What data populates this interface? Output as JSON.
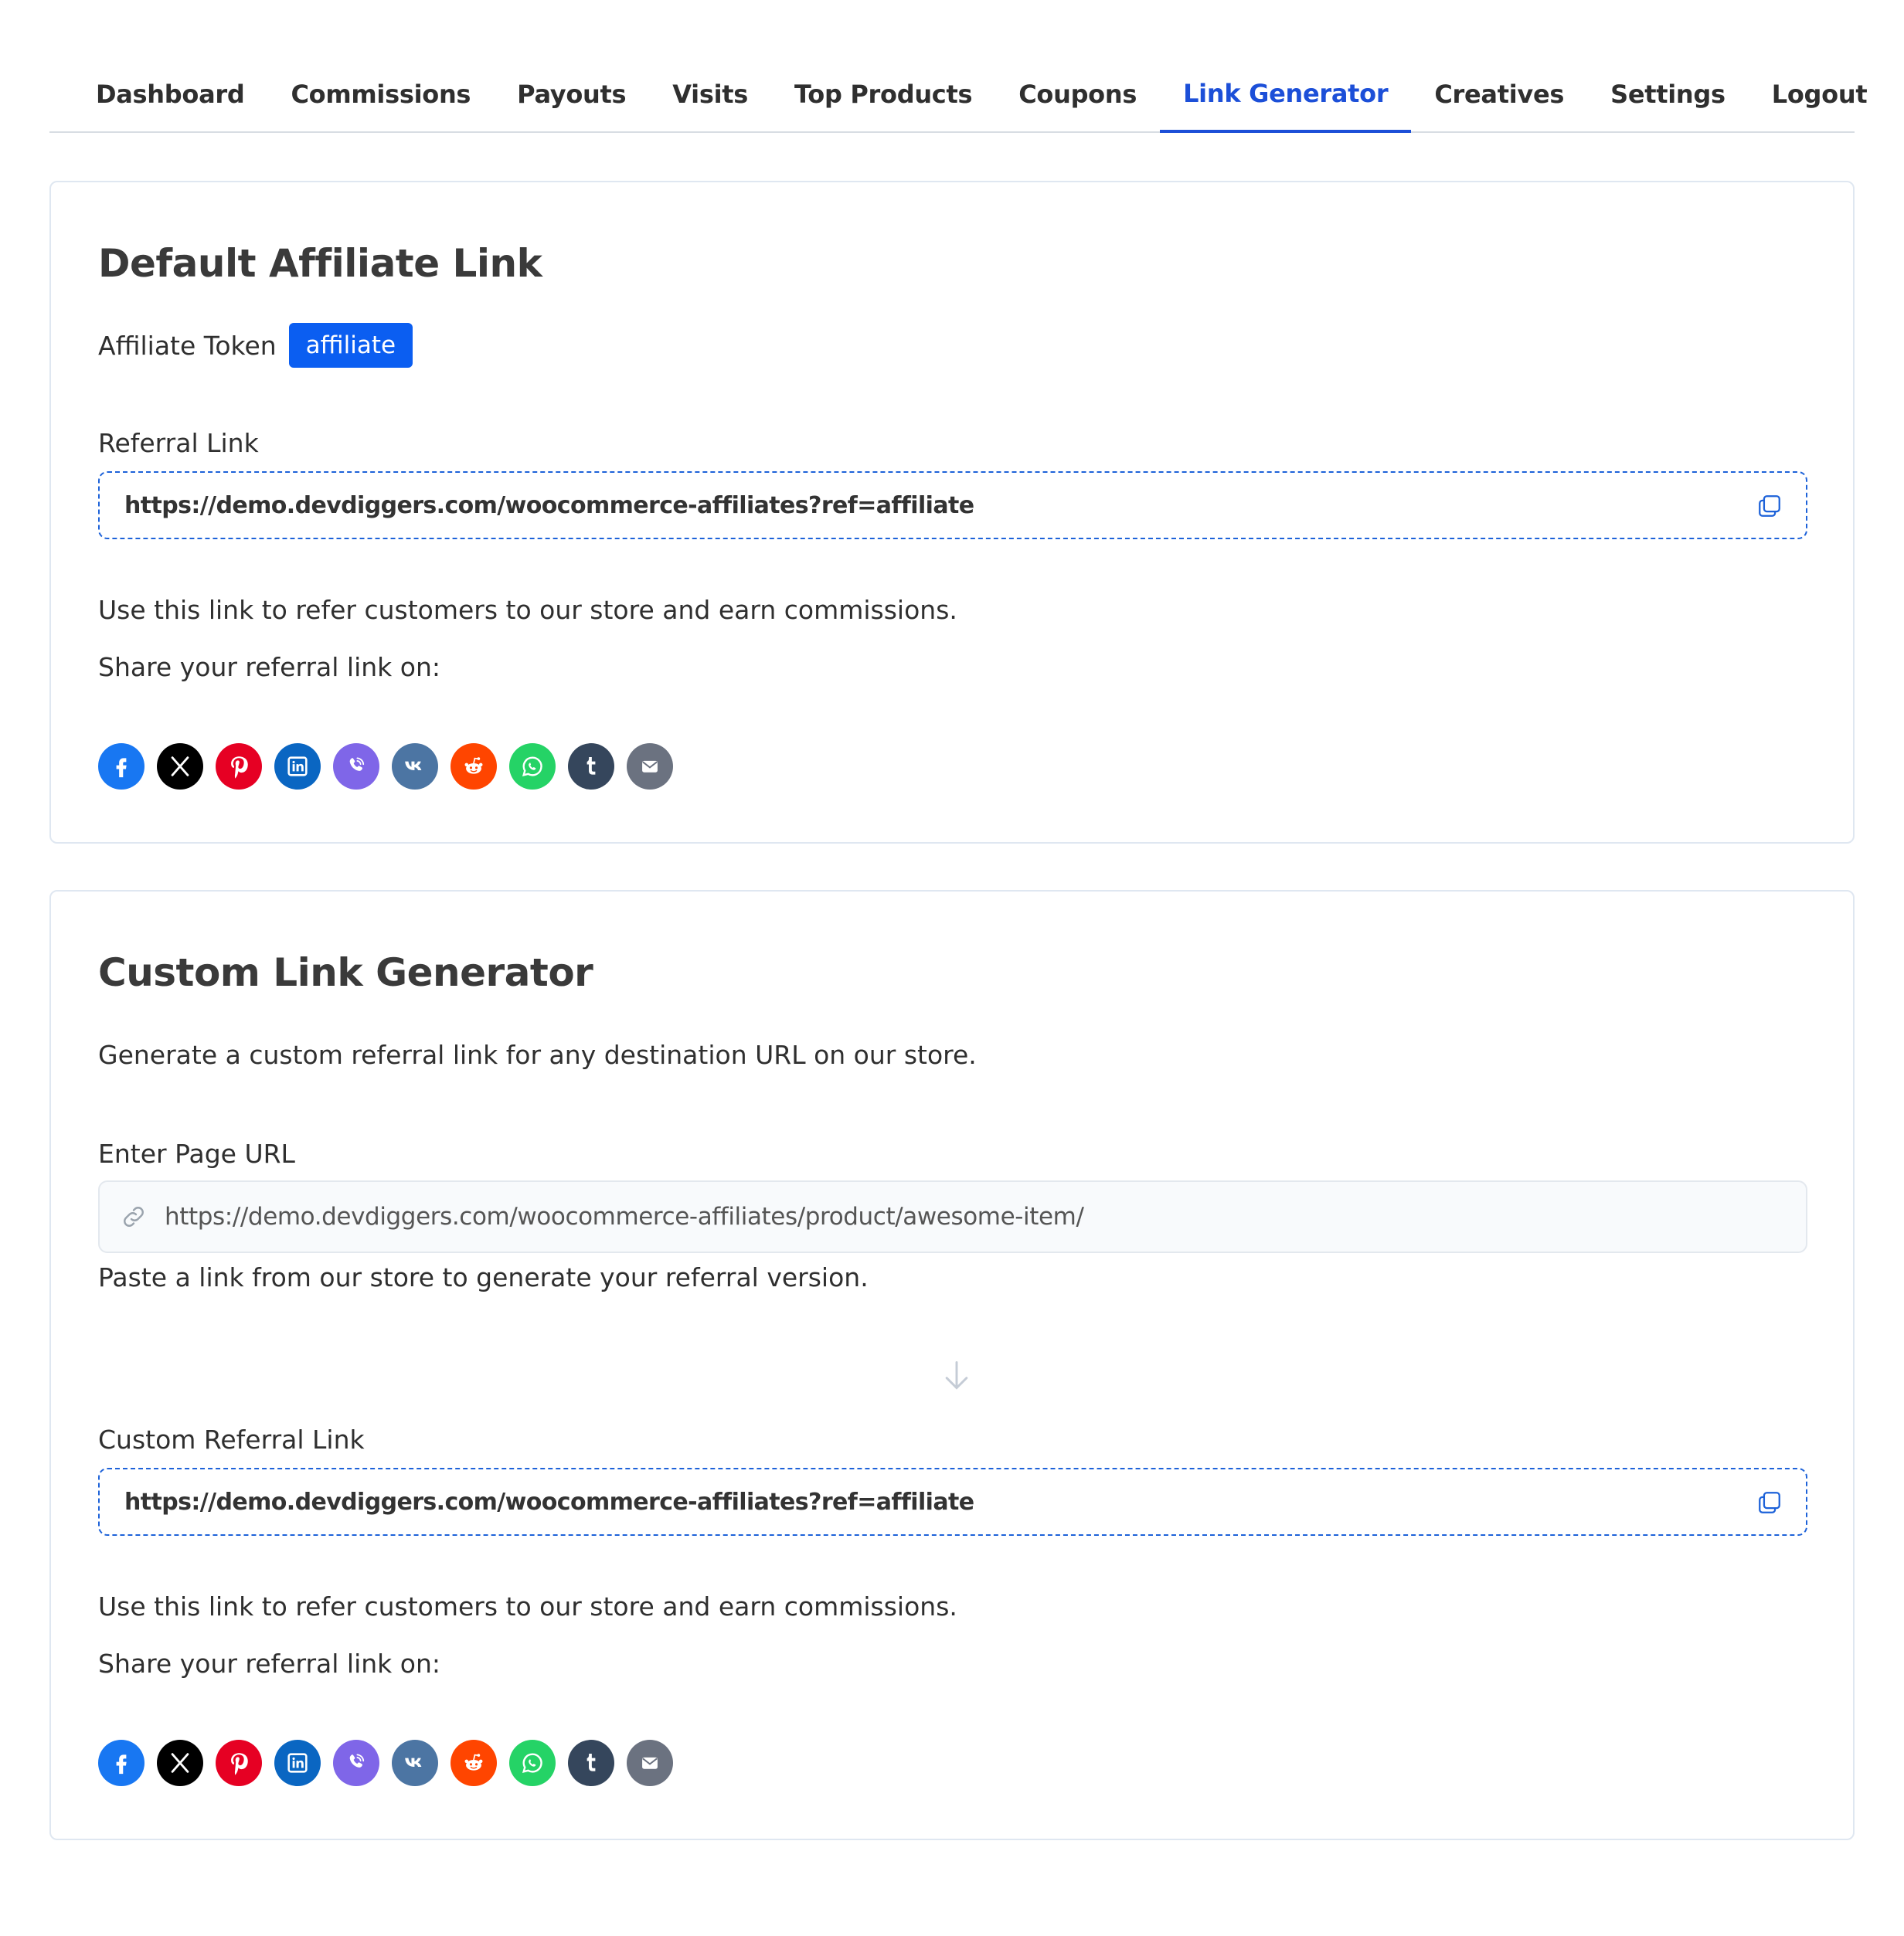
{
  "nav": {
    "tabs": [
      {
        "label": "Dashboard"
      },
      {
        "label": "Commissions"
      },
      {
        "label": "Payouts"
      },
      {
        "label": "Visits"
      },
      {
        "label": "Top Products"
      },
      {
        "label": "Coupons"
      },
      {
        "label": "Link Generator"
      },
      {
        "label": "Creatives"
      },
      {
        "label": "Settings"
      },
      {
        "label": "Logout"
      }
    ],
    "active_tab": "Link Generator",
    "active_color": "#1c4fd8"
  },
  "default_link": {
    "title": "Default Affiliate Link",
    "token_label": "Affiliate Token",
    "token_value": "affiliate",
    "referral_label": "Referral Link",
    "referral_url": "https://demo.devdiggers.com/woocommerce-affiliates?ref=affiliate",
    "help_text": "Use this link to refer customers to our store and earn commissions.",
    "share_label": "Share your referral link on:"
  },
  "custom_link": {
    "title": "Custom Link Generator",
    "description": "Generate a custom referral link for any destination URL on our store.",
    "page_url_label": "Enter Page URL",
    "page_url_value": "https://demo.devdiggers.com/woocommerce-affiliates/product/awesome-item/",
    "page_url_help": "Paste a link from our store to generate your referral version.",
    "custom_label": "Custom Referral Link",
    "custom_url": "https://demo.devdiggers.com/woocommerce-affiliates?ref=affiliate",
    "help_text": "Use this link to refer customers to our store and earn commissions.",
    "share_label": "Share your referral link on:"
  },
  "share_networks": [
    {
      "icon": "facebook-icon",
      "color": "#1877f2"
    },
    {
      "icon": "x-icon",
      "color": "#000000"
    },
    {
      "icon": "pinterest-icon",
      "color": "#e60023"
    },
    {
      "icon": "linkedin-icon",
      "color": "#0a66c2"
    },
    {
      "icon": "viber-icon",
      "color": "#7f66e8"
    },
    {
      "icon": "vk-icon",
      "color": "#4c75a3"
    },
    {
      "icon": "reddit-icon",
      "color": "#ff4500"
    },
    {
      "icon": "whatsapp-icon",
      "color": "#25d366"
    },
    {
      "icon": "tumblr-icon",
      "color": "#35465c"
    },
    {
      "icon": "email-icon",
      "color": "#6b7280"
    }
  ],
  "colors": {
    "accent": "#0b5ef1",
    "dashed_border": "#1d62d9",
    "card_border": "#dfe7f1"
  }
}
